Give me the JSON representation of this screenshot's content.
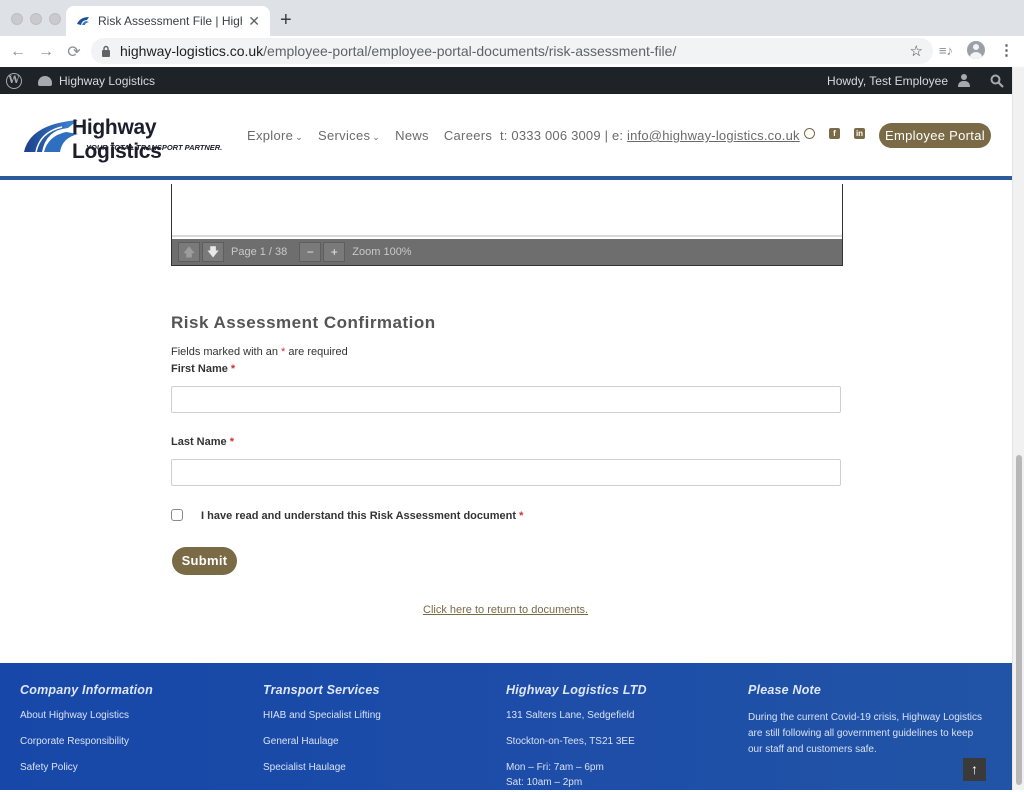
{
  "browser": {
    "tab_title": "Risk Assessment File | Highway",
    "tab_close": "✕",
    "new_tab": "+",
    "url_host": "highway-logistics.co.uk",
    "url_path": "/employee-portal/employee-portal-documents/risk-assessment-file/",
    "back": "←",
    "forward": "→",
    "reload": "⟳",
    "star": "☆",
    "media": "≡♪",
    "menu": "⋮"
  },
  "adminbar": {
    "wp_logo": "W",
    "site_name": "Highway Logistics",
    "howdy": "Howdy, Test Employee"
  },
  "header": {
    "brand": "Highway Logistics",
    "tagline": "YOUR TOTAL TRANSPORT PARTNER.",
    "nav": [
      {
        "label": "Explore",
        "caret": "⌄"
      },
      {
        "label": "Services",
        "caret": "⌄"
      },
      {
        "label": "News"
      },
      {
        "label": "Careers"
      }
    ],
    "phone_text": "t: 0333 006 3009 | e: ",
    "email": "info@highway-logistics.co.uk",
    "social": {
      "facebook": "f",
      "linkedin": "in"
    },
    "portal_button": "Employee Portal"
  },
  "pdf_viewer": {
    "prev_icon": "🡅",
    "next_icon": "🡇",
    "page_label": "Page 1 / 38",
    "zoom_out": "−",
    "zoom_in": "+",
    "zoom_label": "Zoom 100%"
  },
  "form": {
    "title": "Risk Assessment Confirmation",
    "required_note_prefix": "Fields marked with an ",
    "required_note_suffix": " are required",
    "asterisk": "*",
    "first_name_label": "First Name",
    "first_name_value": "",
    "last_name_label": "Last Name",
    "last_name_value": "",
    "checkbox_label": "I have read and understand this Risk Assessment document",
    "checkbox_checked": false,
    "submit": "Submit",
    "return_link": "Click here to return to documents."
  },
  "footer": {
    "columns": [
      {
        "heading": "Company Information",
        "items": [
          "About Highway Logistics",
          "Corporate Responsibility",
          "Safety Policy"
        ]
      },
      {
        "heading": "Transport Services",
        "items": [
          "HIAB and Specialist Lifting",
          "General Haulage",
          "Specialist Haulage"
        ]
      },
      {
        "heading": "Highway Logistics LTD",
        "items": [
          "131 Salters Lane, Sedgefield",
          "Stockton-on-Tees, TS21 3EE",
          "Mon – Fri: 7am – 6pm",
          "Sat: 10am – 2pm"
        ]
      },
      {
        "heading": "Please Note",
        "note": "During the current Covid-19 crisis, Highway Logistics are still following all government guidelines to keep our staff and customers safe."
      }
    ],
    "back_to_top": "↑"
  },
  "colors": {
    "accent": "#7a6a45",
    "header_rule": "#2d5b9a",
    "footer_bg": "#1e4ea8",
    "admin_bar": "#1d2327"
  }
}
